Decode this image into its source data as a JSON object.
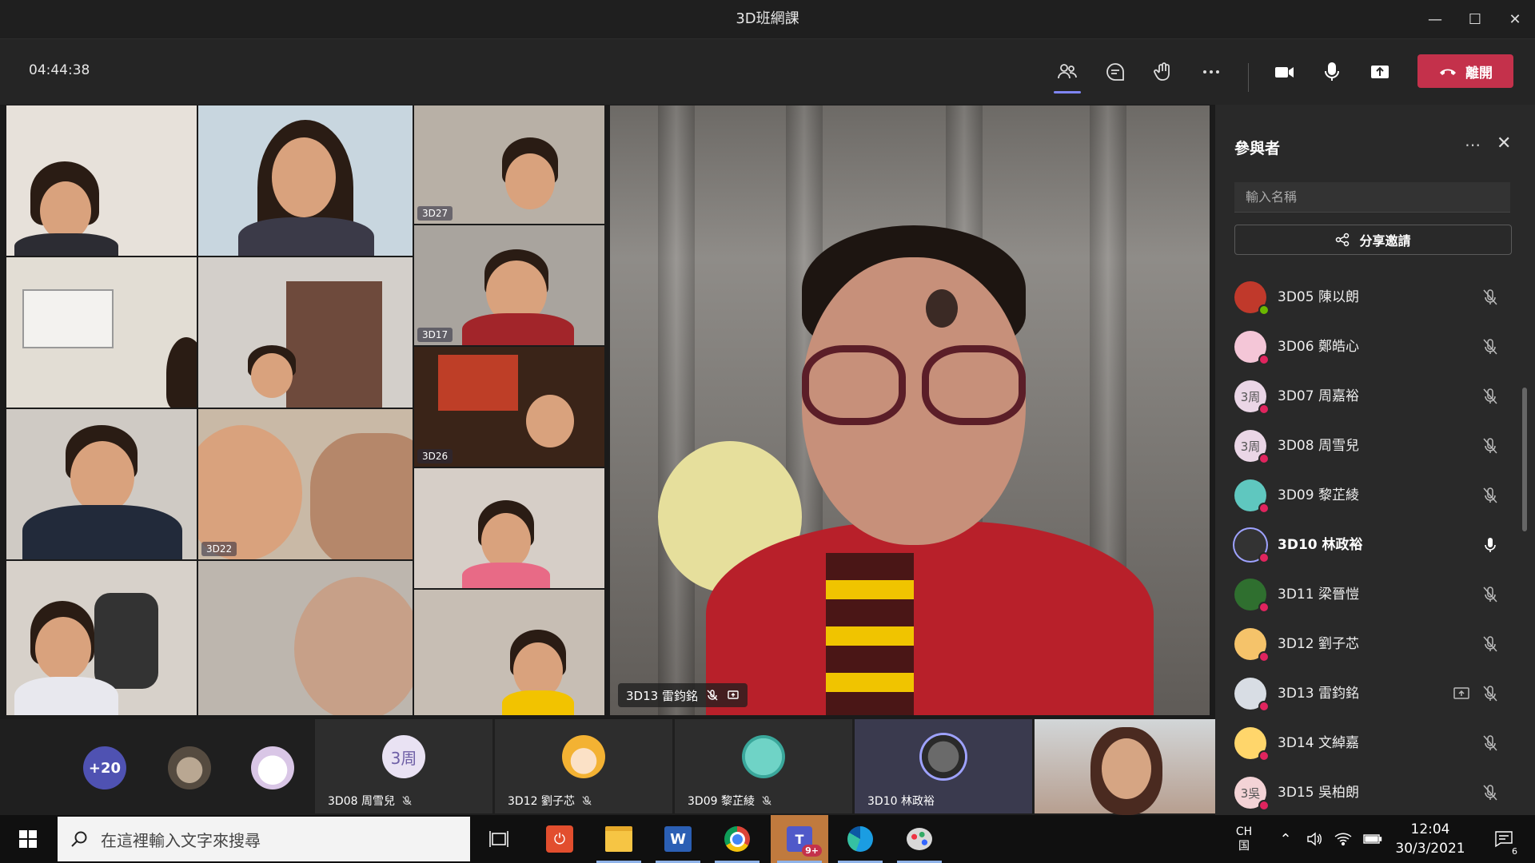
{
  "window": {
    "title": "3D班網課"
  },
  "toolbar": {
    "timer": "04:44:38",
    "leave_label": "離開"
  },
  "main_video": {
    "name": "3D13 雷鈞銘"
  },
  "gallery": [
    {
      "label": ""
    },
    {
      "label": ""
    },
    {
      "label": "3D27"
    },
    {
      "label": ""
    },
    {
      "label": ""
    },
    {
      "label": "3D17"
    },
    {
      "label": ""
    },
    {
      "label": "3D22"
    },
    {
      "label": "3D26"
    },
    {
      "label": ""
    },
    {
      "label": ""
    },
    {
      "label": ""
    },
    {
      "label": ""
    }
  ],
  "strip": {
    "overflow_count": "+20",
    "tiles": [
      {
        "name": "3D08 周雪兒",
        "initials": "3周"
      },
      {
        "name": "3D12 劉子芯",
        "initials": ""
      },
      {
        "name": "3D09 黎芷綾",
        "initials": ""
      },
      {
        "name": "3D10 林政裕",
        "initials": ""
      }
    ]
  },
  "panel": {
    "title": "參與者",
    "search_placeholder": "輸入名稱",
    "share_label": "分享邀請",
    "participants": [
      {
        "name": "3D05 陳以朗",
        "initials": "",
        "status": "green",
        "bold": false
      },
      {
        "name": "3D06 鄭皓心",
        "initials": "",
        "status": "red",
        "bold": false
      },
      {
        "name": "3D07 周嘉裕",
        "initials": "3周",
        "status": "red",
        "bold": false
      },
      {
        "name": "3D08 周雪兒",
        "initials": "3周",
        "status": "red",
        "bold": false
      },
      {
        "name": "3D09 黎芷綾",
        "initials": "",
        "status": "red",
        "bold": false
      },
      {
        "name": "3D10 林政裕",
        "initials": "",
        "status": "red",
        "bold": true
      },
      {
        "name": "3D11 梁晉愷",
        "initials": "",
        "status": "red",
        "bold": false
      },
      {
        "name": "3D12 劉子芯",
        "initials": "",
        "status": "red",
        "bold": false
      },
      {
        "name": "3D13 雷鈞銘",
        "initials": "",
        "status": "red",
        "bold": false
      },
      {
        "name": "3D14 文綽嘉",
        "initials": "",
        "status": "red",
        "bold": false
      },
      {
        "name": "3D15 吳柏朗",
        "initials": "3吳",
        "status": "red",
        "bold": false
      }
    ]
  },
  "taskbar": {
    "search_placeholder": "在這裡輸入文字來搜尋",
    "lang": "CH",
    "time": "12:04",
    "date": "30/3/2021",
    "notification_count": "6",
    "teams_badge": "9+"
  }
}
